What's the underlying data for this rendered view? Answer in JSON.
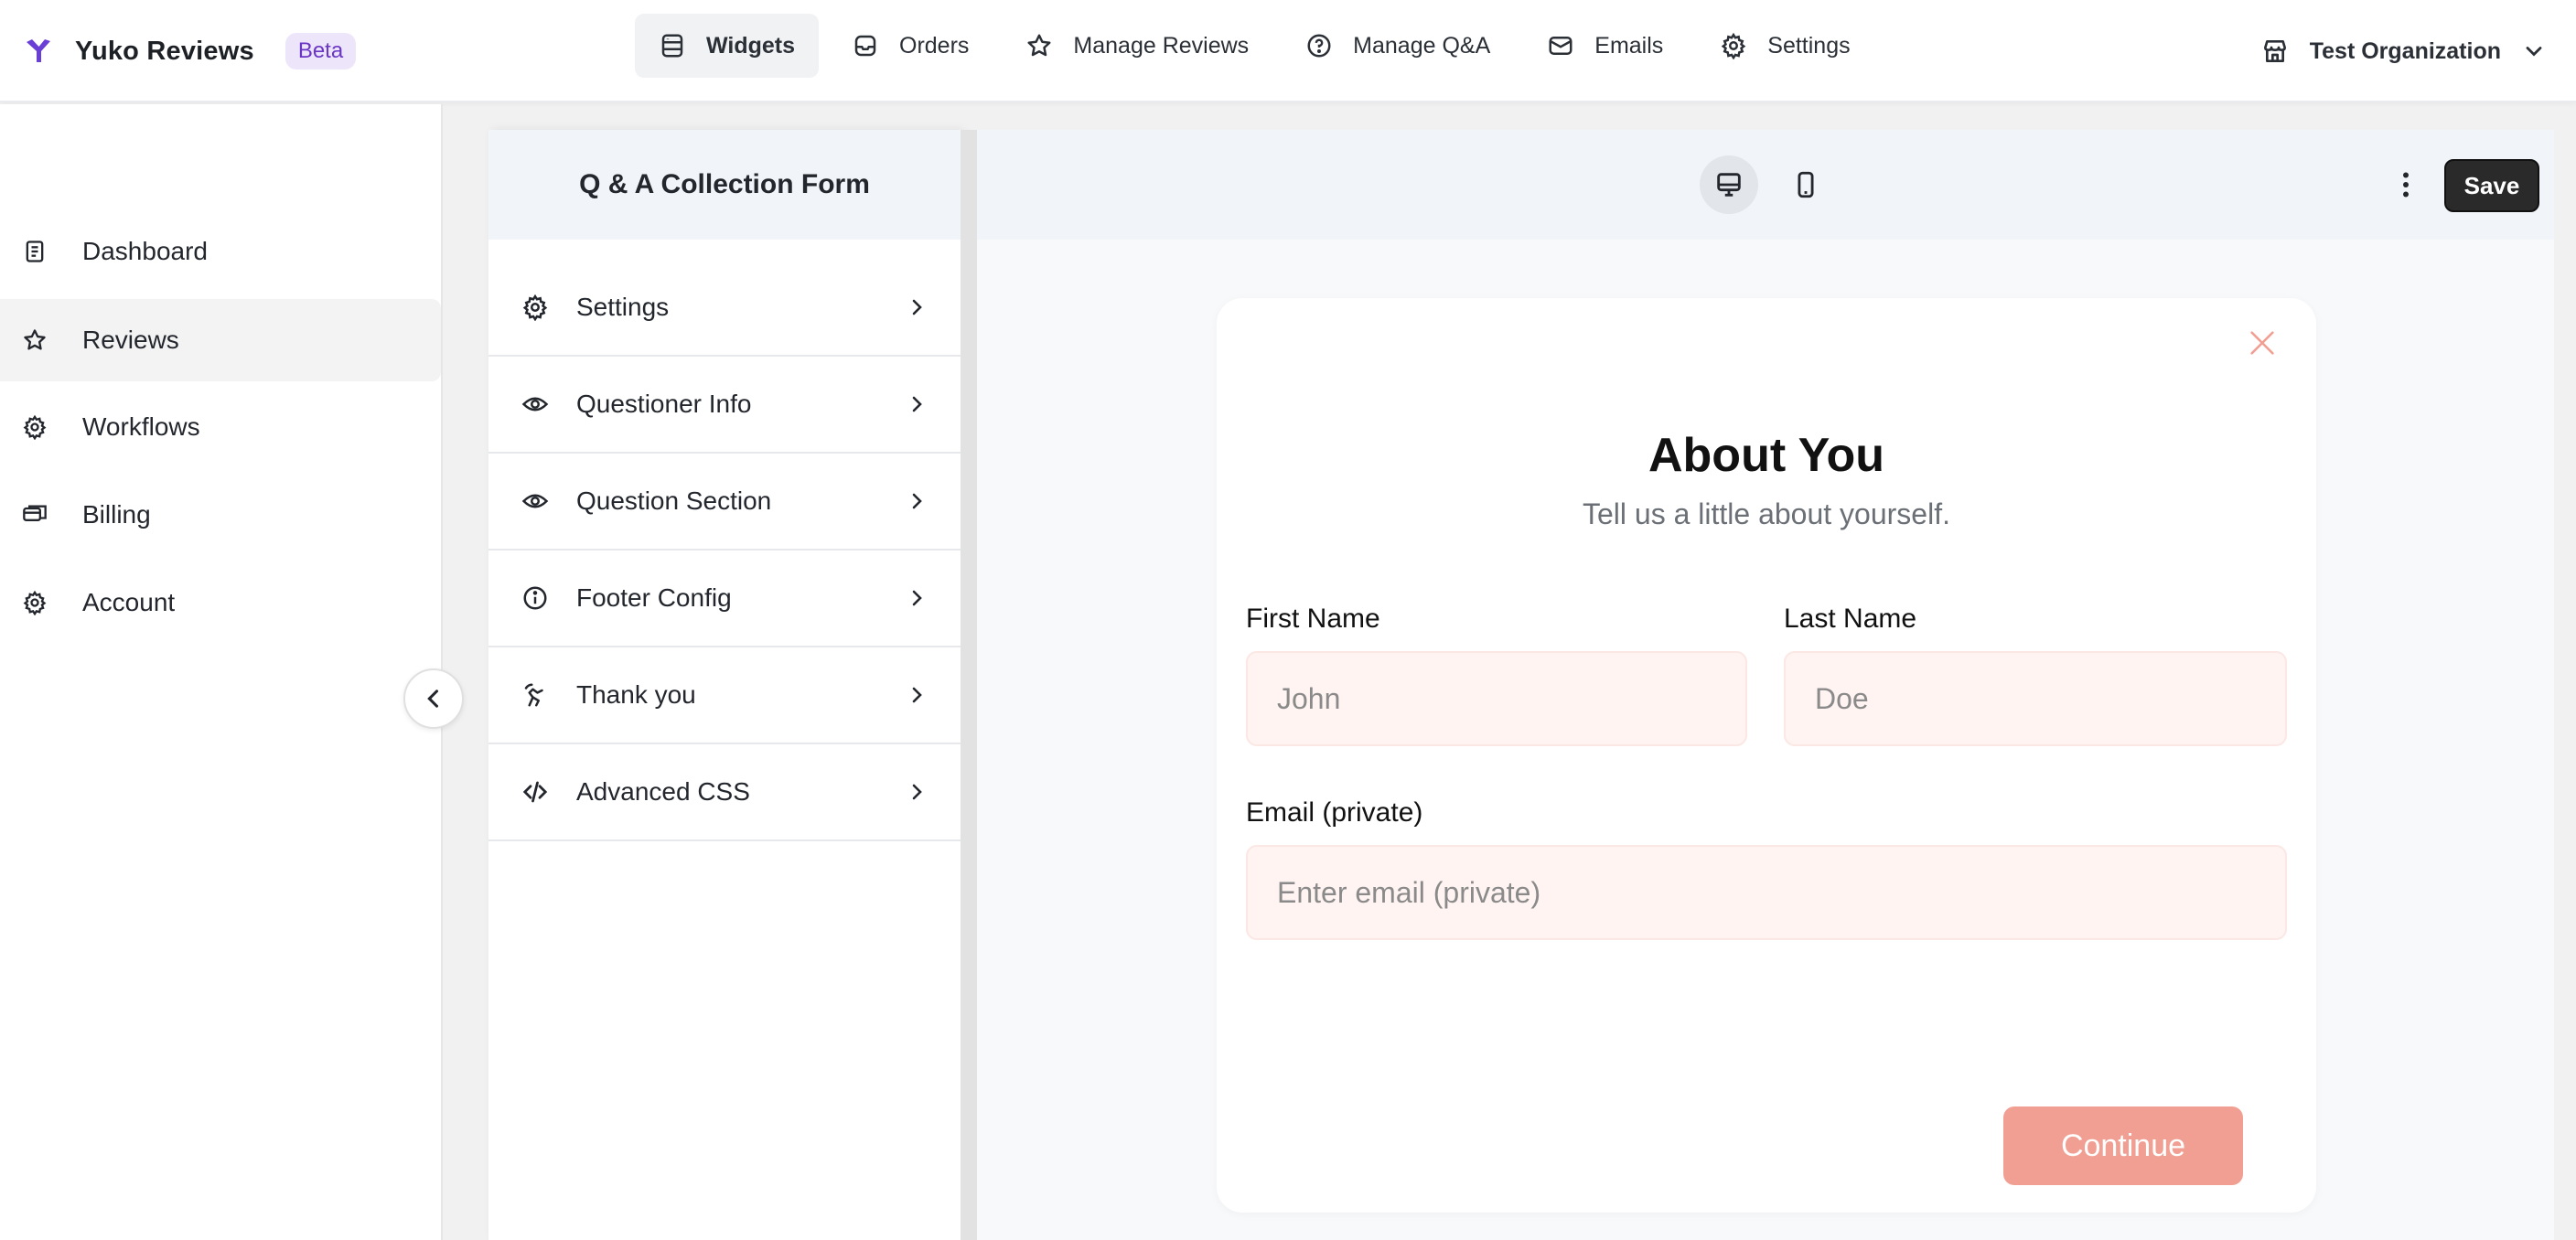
{
  "brand": {
    "name": "Yuko Reviews",
    "badge": "Beta"
  },
  "nav": {
    "items": [
      {
        "label": "Widgets",
        "icon": "widgets-icon",
        "active": true
      },
      {
        "label": "Orders",
        "icon": "inbox-icon"
      },
      {
        "label": "Manage Reviews",
        "icon": "star-icon"
      },
      {
        "label": "Manage Q&A",
        "icon": "question-circle-icon"
      },
      {
        "label": "Emails",
        "icon": "mail-icon"
      },
      {
        "label": "Settings",
        "icon": "gear-icon"
      }
    ]
  },
  "org": {
    "name": "Test Organization",
    "icon": "store-icon"
  },
  "sidebar": {
    "items": [
      {
        "label": "Dashboard",
        "icon": "ledger-icon"
      },
      {
        "label": "Reviews",
        "icon": "star-icon",
        "active": true
      },
      {
        "label": "Workflows",
        "icon": "gear-icon"
      },
      {
        "label": "Billing",
        "icon": "cards-icon"
      },
      {
        "label": "Account",
        "icon": "gear-icon"
      }
    ]
  },
  "panel": {
    "title": "Q & A Collection Form",
    "items": [
      {
        "label": "Settings",
        "icon": "gear-icon"
      },
      {
        "label": "Questioner Info",
        "icon": "eye-gear-icon"
      },
      {
        "label": "Question Section",
        "icon": "eye-gear-icon"
      },
      {
        "label": "Footer Config",
        "icon": "info-icon"
      },
      {
        "label": "Thank you",
        "icon": "wave-hand-icon"
      },
      {
        "label": "Advanced CSS",
        "icon": "code-icon"
      }
    ]
  },
  "preview": {
    "save_label": "Save",
    "form": {
      "title": "About You",
      "subtitle": "Tell us a little about yourself.",
      "first_name_label": "First Name",
      "first_name_placeholder": "John",
      "last_name_label": "Last Name",
      "last_name_placeholder": "Doe",
      "email_label": "Email (private)",
      "email_placeholder": "Enter email (private)",
      "continue_label": "Continue"
    }
  },
  "colors": {
    "accent": "#f19f92",
    "input_bg": "#fff4f2",
    "save_bg": "#2a2a2a",
    "beta_bg": "#ede6fb",
    "beta_text": "#6a36c4",
    "logo": "#6a3fd6"
  }
}
